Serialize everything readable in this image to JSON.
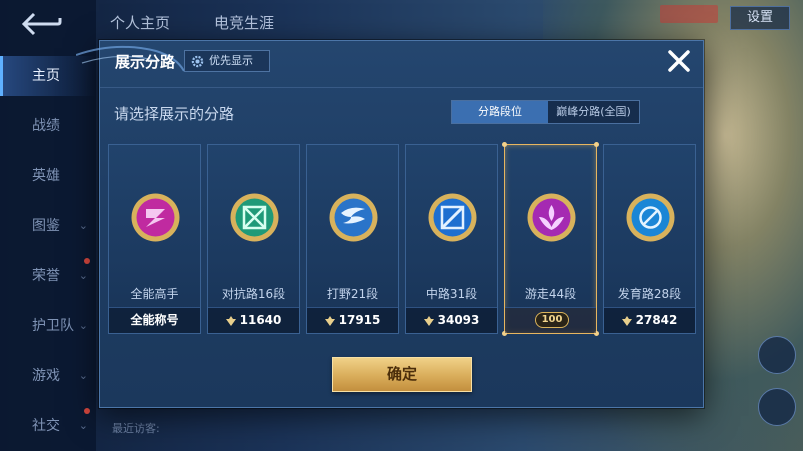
{
  "background": {
    "sidebar": [
      {
        "label": "主页",
        "active": true
      },
      {
        "label": "战绩"
      },
      {
        "label": "英雄"
      },
      {
        "label": "图鉴"
      },
      {
        "label": "荣誉"
      },
      {
        "label": "护卫队"
      },
      {
        "label": "游戏"
      },
      {
        "label": "社交"
      }
    ],
    "top_tabs": [
      "个人主页",
      "电竞生涯"
    ],
    "settings_label": "设置",
    "recent_visitors": "最近访客:"
  },
  "modal": {
    "title": "展示分路",
    "priority_button": "优先显示",
    "close_icon": "close-icon",
    "subtitle": "请选择展示的分路",
    "segments": [
      {
        "label": "分路段位",
        "selected": true
      },
      {
        "label": "巅峰分路(全国)",
        "selected": false
      }
    ],
    "cards": [
      {
        "name": "全能高手",
        "footer": "全能称号",
        "score": null,
        "selected": false,
        "icon": "all-rounder-emblem-icon"
      },
      {
        "name": "对抗路16段",
        "footer": "11640",
        "score": true,
        "selected": false,
        "icon": "clash-lane-emblem-icon"
      },
      {
        "name": "打野21段",
        "footer": "17915",
        "score": true,
        "selected": false,
        "icon": "jungle-emblem-icon"
      },
      {
        "name": "中路31段",
        "footer": "34093",
        "score": true,
        "selected": false,
        "icon": "mid-lane-emblem-icon"
      },
      {
        "name": "游走44段",
        "footer": "100",
        "score": false,
        "selected": true,
        "icon": "roam-emblem-icon"
      },
      {
        "name": "发育路28段",
        "footer": "27842",
        "score": true,
        "selected": false,
        "icon": "farm-lane-emblem-icon"
      }
    ],
    "confirm_label": "确定"
  },
  "colors": {
    "accent_blue": "#3b6fb1",
    "selected_gold": "#e7b660",
    "confirm_gold": "#d9ad5a"
  }
}
